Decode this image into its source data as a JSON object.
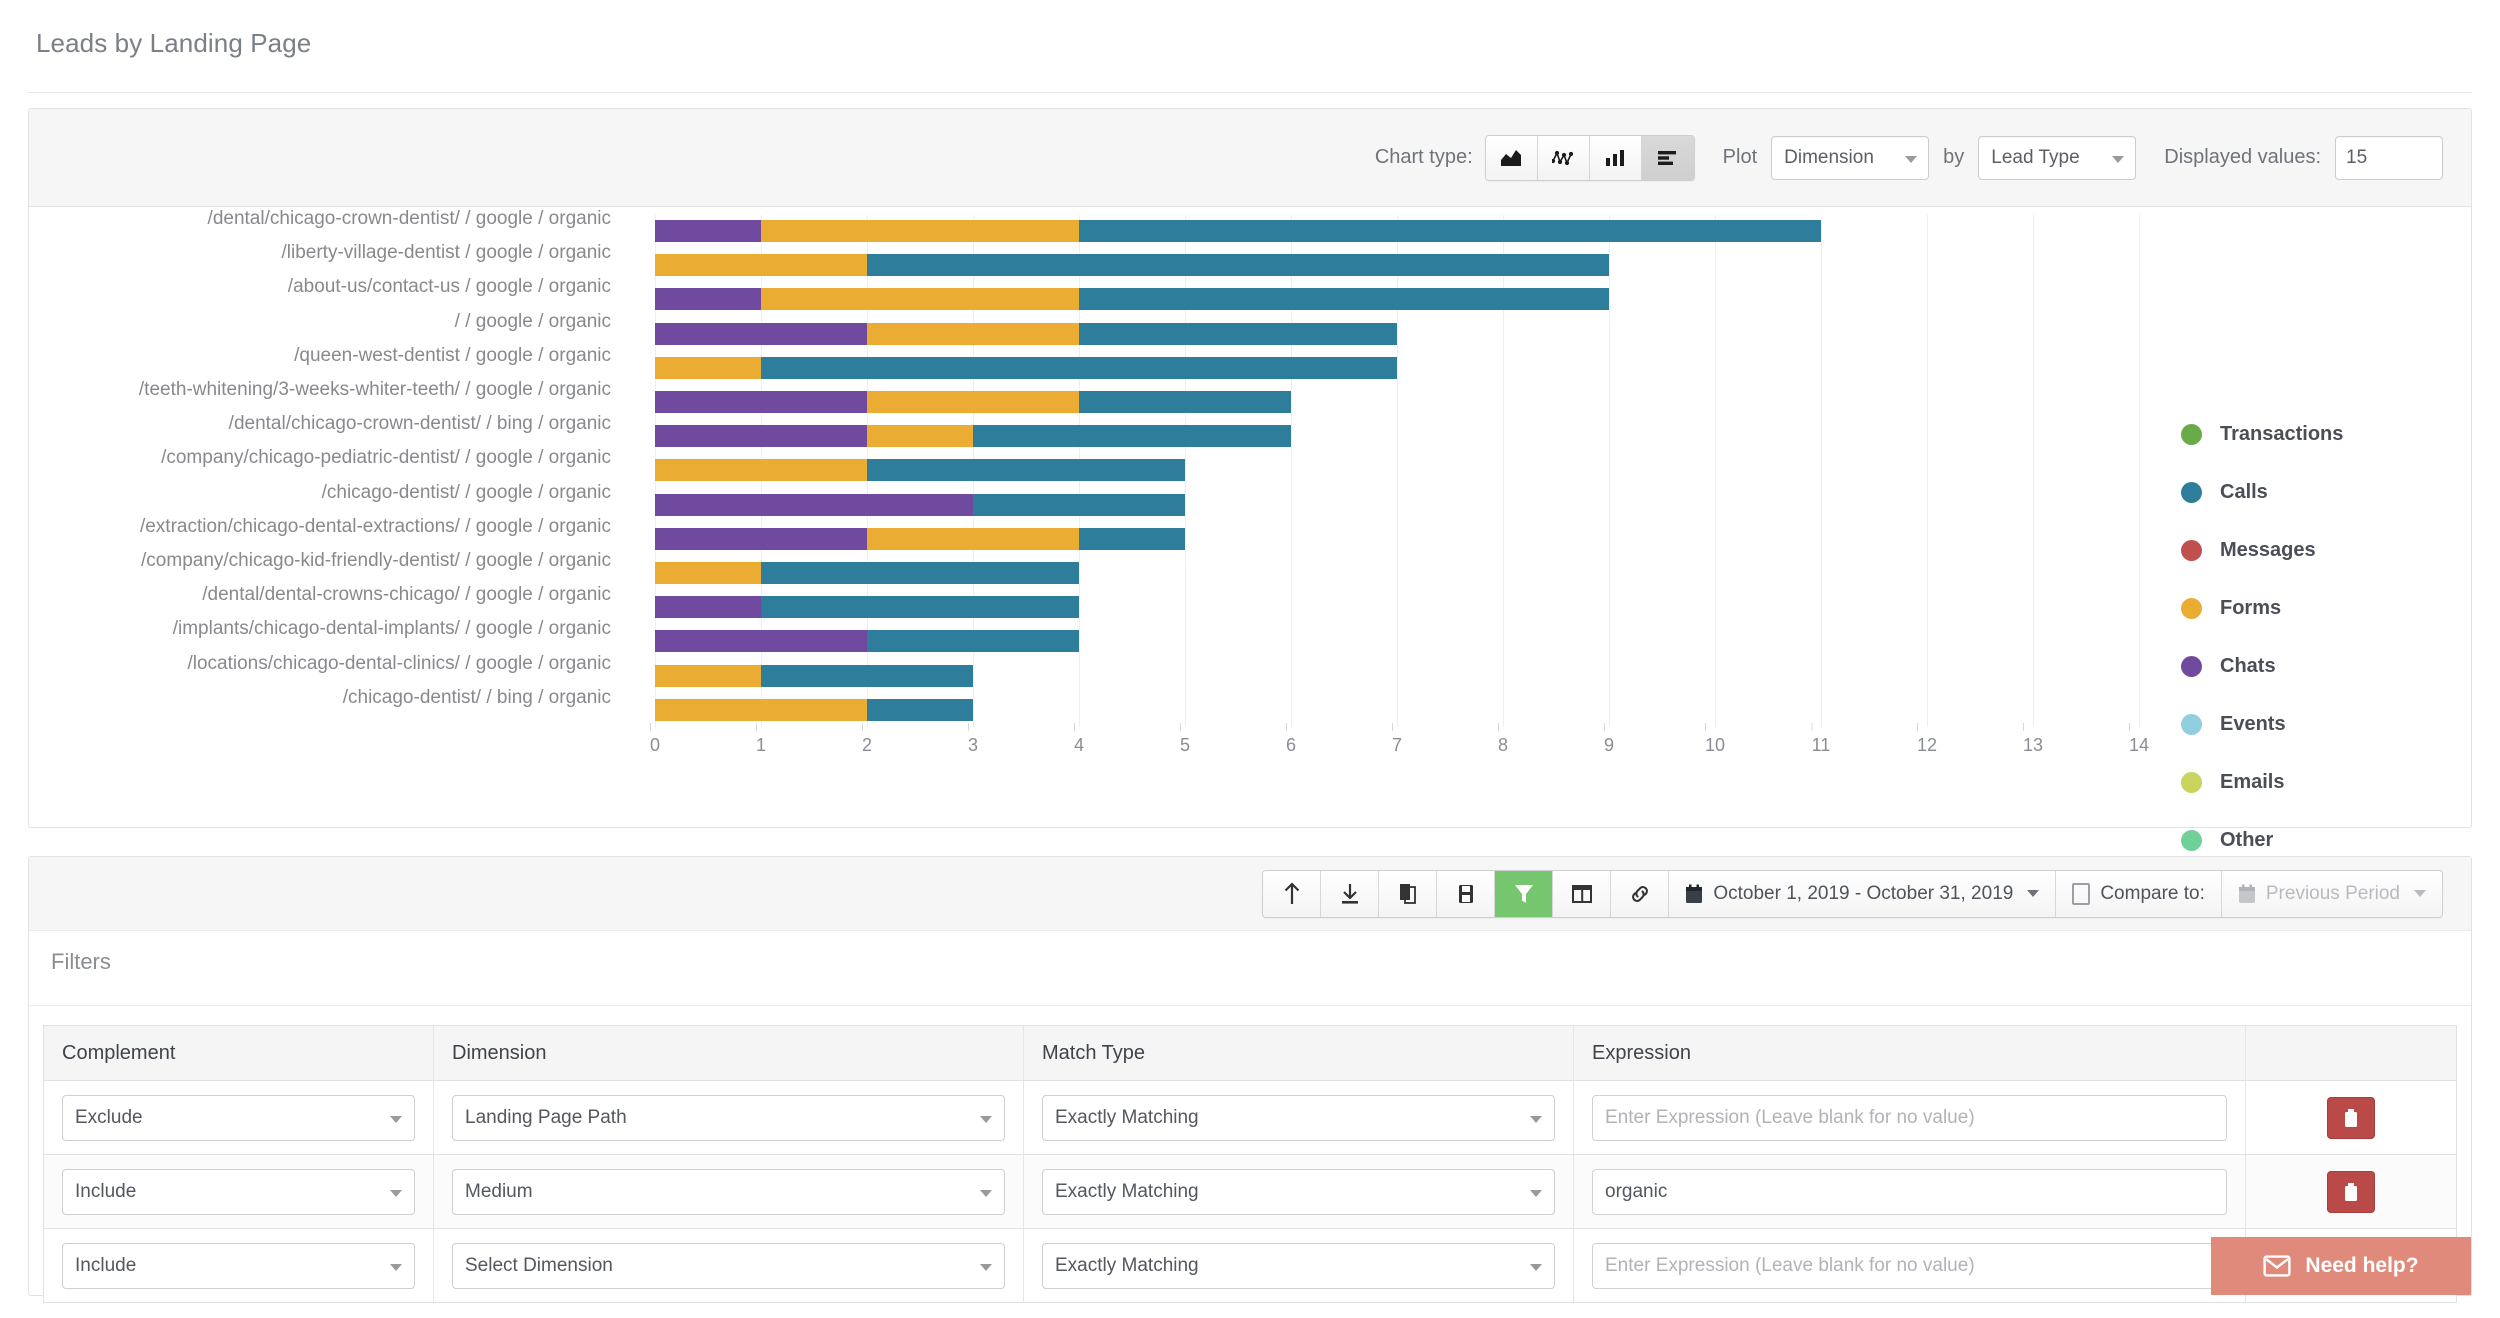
{
  "page": {
    "title": "Leads by Landing Page"
  },
  "chart_toolbar": {
    "chart_type_label": "Chart type:",
    "chart_types": [
      {
        "name": "area-chart-icon",
        "active": false
      },
      {
        "name": "line-chart-icon",
        "active": false
      },
      {
        "name": "column-chart-icon",
        "active": false
      },
      {
        "name": "bar-chart-icon",
        "active": true
      }
    ],
    "plot_label": "Plot",
    "plot_value": "Dimension",
    "by_label": "by",
    "by_value": "Lead Type",
    "displayed_values_label": "Displayed values:",
    "displayed_values": "15"
  },
  "chart_data": {
    "type": "bar",
    "orientation": "horizontal",
    "stacked": true,
    "title": "Leads by Landing Page",
    "xlabel": "",
    "ylabel": "",
    "xlim": [
      0,
      14
    ],
    "xticks": [
      0,
      1,
      2,
      3,
      4,
      5,
      6,
      7,
      8,
      9,
      10,
      11,
      12,
      13,
      14
    ],
    "grid": true,
    "legend_position": "right",
    "categories": [
      "/dental/chicago-crown-dentist/ / google / organic",
      "/liberty-village-dentist / google / organic",
      "/about-us/contact-us / google / organic",
      "/ / google / organic",
      "/queen-west-dentist / google / organic",
      "/teeth-whitening/3-weeks-whiter-teeth/ / google / organic",
      "/dental/chicago-crown-dentist/ / bing / organic",
      "/company/chicago-pediatric-dentist/ / google / organic",
      "/chicago-dentist/ / google / organic",
      "/extraction/chicago-dental-extractions/ / google / organic",
      "/company/chicago-kid-friendly-dentist/ / google / organic",
      "/dental/dental-crowns-chicago/ / google / organic",
      "/implants/chicago-dental-implants/ / google / organic",
      "/locations/chicago-dental-clinics/ / google / organic",
      "/chicago-dentist/ / bing / organic"
    ],
    "series": [
      {
        "name": "Transactions",
        "color": "#6aab49",
        "values": [
          0,
          0,
          0,
          0,
          0,
          0,
          0,
          0,
          0,
          0,
          0,
          0,
          0,
          0,
          0
        ]
      },
      {
        "name": "Calls",
        "color": "#2e7d9a",
        "values": [
          7,
          7,
          5,
          3,
          6,
          2,
          3,
          3,
          2,
          1,
          3,
          3,
          2,
          2,
          1
        ]
      },
      {
        "name": "Messages",
        "color": "#c0504d",
        "values": [
          0,
          0,
          0,
          0,
          0,
          0,
          0,
          0,
          0,
          0,
          0,
          0,
          0,
          0,
          0
        ]
      },
      {
        "name": "Forms",
        "color": "#eaac32",
        "values": [
          3,
          2,
          3,
          2,
          1,
          2,
          1,
          2,
          0,
          2,
          1,
          0,
          0,
          1,
          2
        ]
      },
      {
        "name": "Chats",
        "color": "#6f4a9e",
        "values": [
          1,
          0,
          1,
          2,
          0,
          2,
          2,
          0,
          3,
          2,
          0,
          1,
          2,
          0,
          0
        ]
      },
      {
        "name": "Events",
        "color": "#8fcfe0",
        "values": [
          0,
          0,
          0,
          0,
          0,
          0,
          0,
          0,
          0,
          0,
          0,
          0,
          0,
          0,
          0
        ]
      },
      {
        "name": "Emails",
        "color": "#c8d45e",
        "values": [
          0,
          0,
          0,
          0,
          0,
          0,
          0,
          0,
          0,
          0,
          0,
          0,
          0,
          0,
          0
        ]
      },
      {
        "name": "Other",
        "color": "#6fd198",
        "values": [
          0,
          0,
          0,
          0,
          0,
          0,
          0,
          0,
          0,
          0,
          0,
          0,
          0,
          0,
          0
        ]
      }
    ],
    "totals": [
      11,
      9,
      9,
      7,
      7,
      6,
      6,
      5,
      5,
      5,
      4,
      4,
      4,
      3,
      3
    ],
    "stack_order": [
      "Chats",
      "Forms",
      "Calls"
    ]
  },
  "actions": {
    "buttons": [
      {
        "name": "upload-icon",
        "label": ""
      },
      {
        "name": "download-icon",
        "label": ""
      },
      {
        "name": "copy-icon",
        "label": ""
      },
      {
        "name": "save-icon",
        "label": ""
      },
      {
        "name": "filter-icon",
        "label": "",
        "active": true
      },
      {
        "name": "columns-icon",
        "label": ""
      },
      {
        "name": "link-icon",
        "label": ""
      }
    ],
    "date_range": "October 1, 2019 - October 31, 2019",
    "compare_label": "Compare to:",
    "previous_period": "Previous Period"
  },
  "filters": {
    "title": "Filters",
    "columns": [
      "Complement",
      "Dimension",
      "Match Type",
      "Expression",
      ""
    ],
    "rows": [
      {
        "complement": "Exclude",
        "dimension": "Landing Page Path",
        "match_type": "Exactly Matching",
        "expression": "",
        "expression_placeholder": "Enter Expression (Leave blank for no value)",
        "action": "delete"
      },
      {
        "complement": "Include",
        "dimension": "Medium",
        "match_type": "Exactly Matching",
        "expression": "organic",
        "expression_placeholder": "Enter Expression (Leave blank for no value)",
        "action": "delete"
      },
      {
        "complement": "Include",
        "dimension": "Select Dimension",
        "match_type": "Exactly Matching",
        "expression": "",
        "expression_placeholder": "Enter Expression (Leave blank for no value)",
        "action": "add"
      }
    ]
  },
  "support": {
    "label": "Need help?",
    "icon": "envelope-icon"
  }
}
